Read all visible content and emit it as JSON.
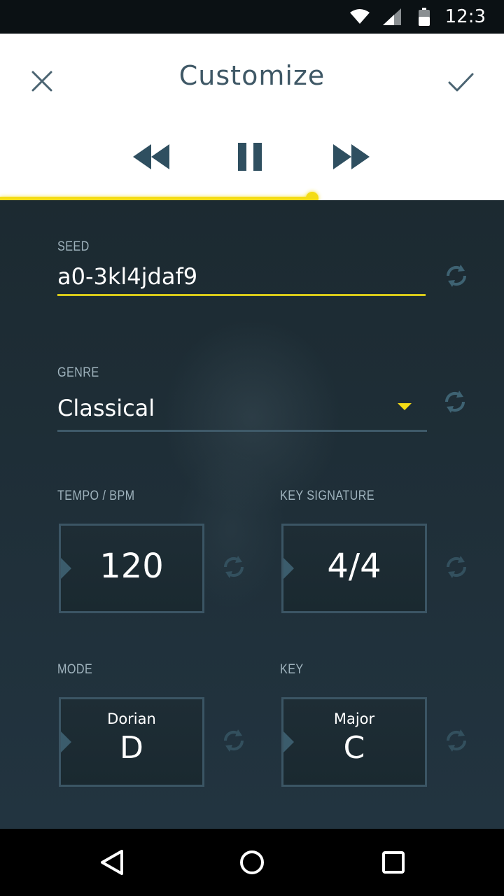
{
  "status_bar": {
    "time": "12:3",
    "icons": [
      "wifi-icon",
      "cell-signal-icon",
      "battery-icon"
    ]
  },
  "header": {
    "title": "Customize",
    "close_icon": "close-icon",
    "confirm_icon": "check-icon"
  },
  "transport": {
    "icons": [
      "rewind-icon",
      "pause-icon",
      "fast-forward-icon"
    ]
  },
  "playback": {
    "progress_fraction": 0.62
  },
  "form": {
    "seed": {
      "label": "SEED",
      "value": "a0-3kl4jdaf9"
    },
    "genre": {
      "label": "GENRE",
      "value": "Classical"
    },
    "tempo": {
      "label": "TEMPO / BPM",
      "value": "120"
    },
    "key_signature": {
      "label": "KEY SIGNATURE",
      "value": "4/4"
    },
    "mode": {
      "label": "MODE",
      "sublabel": "Dorian",
      "value": "D"
    },
    "key": {
      "label": "KEY",
      "sublabel": "Major",
      "value": "C"
    }
  },
  "colors": {
    "accent": "#f4dc16",
    "header_text": "#3f5866",
    "panel_bg": "#1f2f37",
    "box_border": "#3b5564"
  },
  "nav_bar": {
    "icons": [
      "back-icon",
      "home-icon",
      "recents-icon"
    ]
  }
}
